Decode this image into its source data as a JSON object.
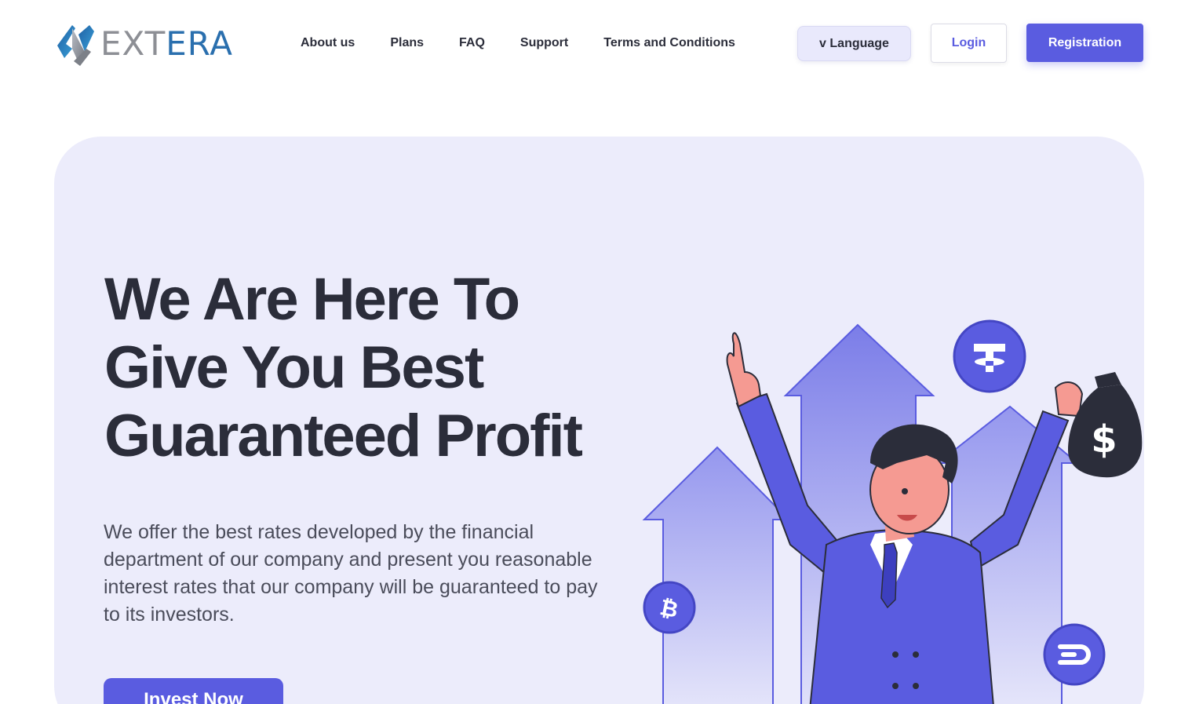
{
  "brand": {
    "logo_prefix": "N",
    "logo_text_gray": "EXT",
    "logo_text_blue": "ERA"
  },
  "nav": {
    "items": [
      {
        "label": "About us"
      },
      {
        "label": "Plans"
      },
      {
        "label": "FAQ"
      },
      {
        "label": "Support"
      },
      {
        "label": "Terms and Conditions"
      }
    ]
  },
  "header": {
    "language_label": "v Language",
    "login_label": "Login",
    "registration_label": "Registration"
  },
  "hero": {
    "title_lines": [
      "We Are Here To",
      "Give You Best",
      "Guaranteed Profit"
    ],
    "text_lines": [
      "We offer the best rates developed by the financial",
      "department of our company and present you reasonable",
      "interest rates that our company will be guaranteed to pay",
      "to its investors."
    ],
    "cta_label": "Invest Now"
  },
  "illustration": {
    "coins": [
      "tether-icon",
      "bitcoin-icon",
      "dash-icon"
    ],
    "money_bag_symbol": "$"
  },
  "colors": {
    "accent": "#5a5ce0",
    "hero_bg": "#ececfb",
    "text_dark": "#2b2d3a",
    "logo_blue": "#2a6fae",
    "logo_gray": "#8d8f95"
  }
}
